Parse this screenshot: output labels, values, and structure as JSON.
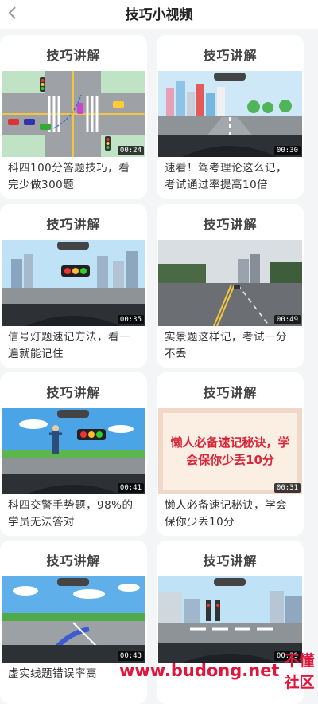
{
  "header": {
    "title": "技巧小视频",
    "back_icon": "chevron-left-icon"
  },
  "cards": [
    {
      "heading": "技巧讲解",
      "duration": "00:24",
      "text": "科四100分答题技巧，看完少做300题"
    },
    {
      "heading": "技巧讲解",
      "duration": "00:30",
      "text": "速看！驾考理论这么记，考试通过率提高10倍"
    },
    {
      "heading": "技巧讲解",
      "duration": "00:35",
      "text": "信号灯题速记方法，看一遍就能记住"
    },
    {
      "heading": "技巧讲解",
      "duration": "00:49",
      "text": "实景题这样记，考试一分不丢"
    },
    {
      "heading": "技巧讲解",
      "duration": "00:41",
      "text": "科四交警手势题，98%的学员无法答对"
    },
    {
      "heading": "技巧讲解",
      "duration": "00:31",
      "text": "懒人必备速记秘诀，学会保你少丢10分",
      "poster": "懒人必备速记秘诀，学会保你少丢10分"
    },
    {
      "heading": "技巧讲解",
      "duration": "00:43",
      "text": "虚实线题错误率高"
    },
    {
      "heading": "技巧讲解",
      "duration": "00:29",
      "text": ""
    }
  ],
  "watermark": {
    "url": "www.budong.net",
    "site": "不懂社区"
  },
  "colors": {
    "accent": "#e0163c",
    "background": "#f3f5f7"
  }
}
